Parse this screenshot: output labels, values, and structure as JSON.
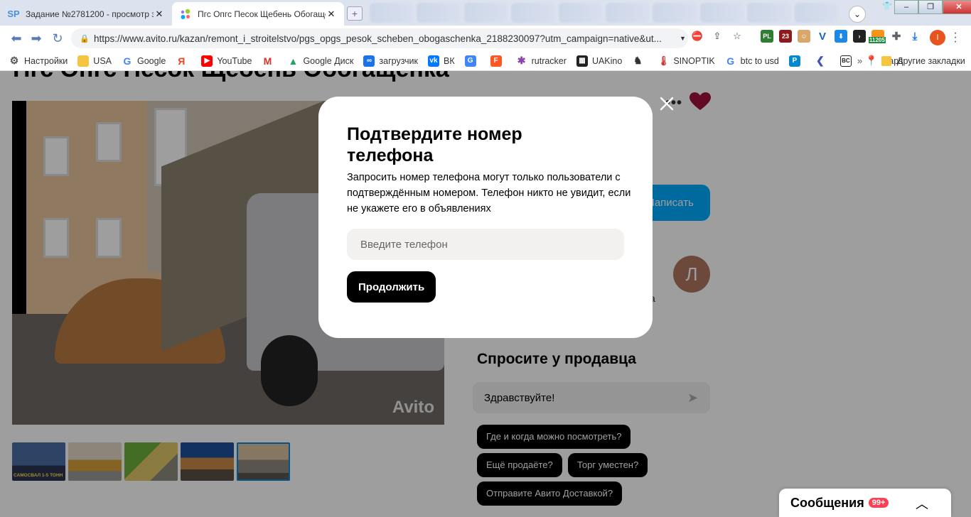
{
  "browser": {
    "tabs": [
      {
        "favicon": "SP",
        "title": "Задание №2781200 - просмотр з..."
      },
      {
        "favicon": "avito-icon",
        "title": "Пгс Опгс Песок Щебень Обогаще..."
      }
    ],
    "url": "https://www.avito.ru/kazan/remont_i_stroitelstvo/pgs_opgs_pesok_scheben_obogaschenka_2188230097?utm_campaign=native&ut...",
    "extension_badge": "11205",
    "profile_letter": "I",
    "bookmarks": [
      {
        "label": "Настройки",
        "icon": "gear-icon",
        "color": "#555555"
      },
      {
        "label": "USA",
        "icon": "folder-icon",
        "color": "#f5c542"
      },
      {
        "label": "Google",
        "icon": "google-icon",
        "color": "#4285f4"
      },
      {
        "label": "",
        "icon": "yandex-icon",
        "color": "#fc3f1d"
      },
      {
        "label": "YouTube",
        "icon": "youtube-icon",
        "color": "#ff0000"
      },
      {
        "label": "",
        "icon": "gmail-icon",
        "color": "#d93025"
      },
      {
        "label": "Google Диск",
        "icon": "drive-icon",
        "color": "#1fa463"
      },
      {
        "label": "загрузчик",
        "icon": "infinity-icon",
        "color": "#1a73e8"
      },
      {
        "label": "ВК",
        "icon": "vk-icon",
        "color": "#0077ff"
      },
      {
        "label": "",
        "icon": "translate-icon",
        "color": "#4285f4"
      },
      {
        "label": "",
        "icon": "f-icon",
        "color": "#ff5722"
      },
      {
        "label": "rutracker",
        "icon": "star-icon",
        "color": "#8e44ad"
      },
      {
        "label": "UAKino",
        "icon": "film-icon",
        "color": "#222222"
      },
      {
        "label": "",
        "icon": "chess-icon",
        "color": "#333333"
      },
      {
        "label": "SINOPTIK",
        "icon": "thermometer-icon",
        "color": "#d32f2f"
      },
      {
        "label": "btc to usd",
        "icon": "google-icon",
        "color": "#4285f4"
      },
      {
        "label": "",
        "icon": "p-icon",
        "color": "#0288d1"
      },
      {
        "label": "",
        "icon": "arrow-icon",
        "color": "#3f51b5"
      },
      {
        "label": "",
        "icon": "bc-icon",
        "color": "#333333"
      },
      {
        "label": "maps",
        "icon": "maps-icon",
        "color": "#34a853"
      }
    ],
    "bookmarks_more": "»",
    "other_bookmarks": "Другие закладки"
  },
  "page": {
    "title": "Пгс Опгс Песок Щебень Обогащенка",
    "photo_watermark": "Avito",
    "thumb_caption": "САМОСВАЛ 1-5 ТОНН",
    "write_button": "Написать",
    "seller_avatar": "Л",
    "seller_fragment": "а",
    "ask_title": "Спросите у продавца",
    "ask_input": "Здравствуйте!",
    "quick_questions": [
      "Где и когда можно посмотреть?",
      "Ещё продаёте?",
      "Торг уместен?",
      "Отправите Авито Доставкой?"
    ],
    "messages_label": "Сообщения",
    "messages_badge": "99+"
  },
  "modal": {
    "title": "Подтвердите номер телефона",
    "text": "Запросить номер телефона могут только пользователи с подтверждённым номером. Телефон никто не увидит, если не укажете его в объявлениях",
    "phone_placeholder": "Введите телефон",
    "continue_label": "Продолжить"
  },
  "colors": {
    "avito_blue": "#00aaff",
    "favorite_heart": "#a0133a",
    "badge_red": "#ff4053",
    "thumb_selected": "#0a88d8"
  }
}
